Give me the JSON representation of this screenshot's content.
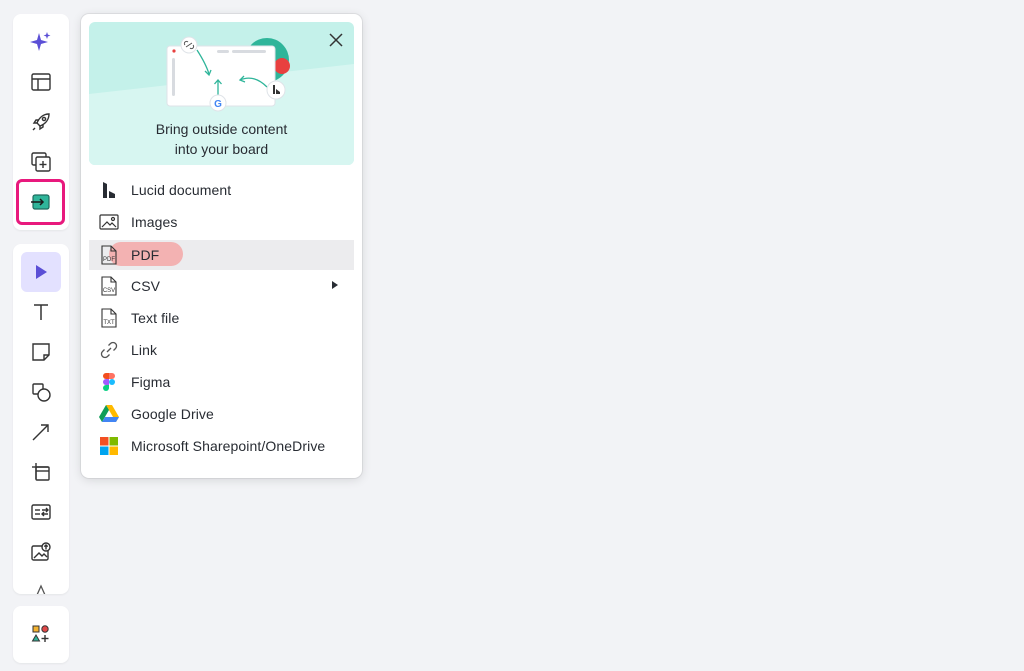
{
  "import_panel": {
    "hero_title_line1": "Bring outside content",
    "hero_title_line2": "into your board",
    "items": [
      {
        "label": "Lucid document",
        "icon": "lucid-logo-icon"
      },
      {
        "label": "Images",
        "icon": "image-icon"
      },
      {
        "label": "PDF",
        "icon": "pdf-file-icon"
      },
      {
        "label": "CSV",
        "icon": "csv-file-icon"
      },
      {
        "label": "Text file",
        "icon": "txt-file-icon"
      },
      {
        "label": "Link",
        "icon": "link-icon"
      },
      {
        "label": "Figma",
        "icon": "figma-icon"
      },
      {
        "label": "Google Drive",
        "icon": "google-drive-icon"
      },
      {
        "label": "Microsoft Sharepoint/OneDrive",
        "icon": "microsoft-icon"
      }
    ]
  },
  "colors": {
    "background": "#f2f3f6",
    "hero_bg": "#c4f1ea",
    "active_tool_bg": "#e3e1ff",
    "highlight_border": "#e8197d",
    "pdf_highlight": "#f3b2b2",
    "teal_accent": "#2fb59a"
  }
}
